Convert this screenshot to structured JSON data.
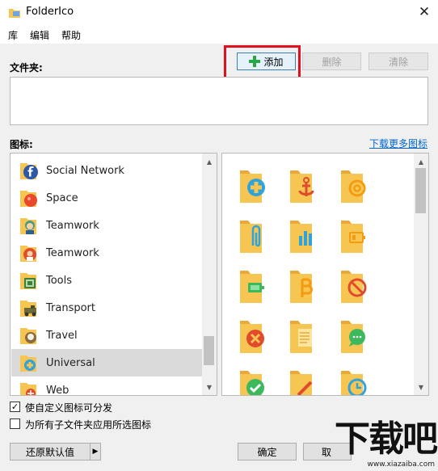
{
  "window": {
    "title": "FolderIco",
    "close_glyph": "✕"
  },
  "menu": [
    "库",
    "编辑",
    "帮助"
  ],
  "folder_section": {
    "label": "文件夹:",
    "add_button": "添加",
    "delete_button": "删除",
    "clear_button": "清除"
  },
  "icons_section": {
    "label": "图标:",
    "download_link": "下载更多图标"
  },
  "icon_list": [
    {
      "name": "Social Network",
      "icon": "facebook-folder-icon",
      "selected": false
    },
    {
      "name": "Space",
      "icon": "space-folder-icon",
      "selected": false
    },
    {
      "name": "Teamwork",
      "icon": "teamwork-folder-icon",
      "selected": false
    },
    {
      "name": "Teamwork",
      "icon": "teamwork-red-folder-icon",
      "selected": false
    },
    {
      "name": "Tools",
      "icon": "tools-folder-icon",
      "selected": false
    },
    {
      "name": "Transport",
      "icon": "transport-folder-icon",
      "selected": false
    },
    {
      "name": "Travel",
      "icon": "travel-folder-icon",
      "selected": false
    },
    {
      "name": "Universal",
      "icon": "universal-folder-icon",
      "selected": true
    },
    {
      "name": "Web",
      "icon": "web-folder-icon",
      "selected": false
    }
  ],
  "icon_grid": [
    "plus-folder-icon",
    "anchor-folder-icon",
    "at-sign-folder-icon",
    "paperclip-folder-icon",
    "bar-chart-folder-icon",
    "battery-low-folder-icon",
    "battery-full-folder-icon",
    "bitcoin-folder-icon",
    "forbidden-folder-icon",
    "delete-folder-icon",
    "document-folder-icon",
    "chat-folder-icon",
    "check-folder-icon",
    "pencil-folder-icon",
    "clock-folder-icon"
  ],
  "options": {
    "custom_distributable": {
      "label": "使自定义图标可分发",
      "checked": true
    },
    "apply_subfolders": {
      "label": "为所有子文件夹应用所选图标",
      "checked": false
    }
  },
  "footer": {
    "restore_default": "还原默认值",
    "ok": "确定",
    "cancel_partial": "取"
  },
  "watermark": {
    "main": "下载吧",
    "url": "www.xiazaiba.com"
  },
  "colors": {
    "folder": "#f7c552",
    "folder_dark": "#e8a93a",
    "accent_blue": "#30a3dd",
    "accent_red": "#e04b2c",
    "accent_green": "#3cb95c",
    "highlight": "#e0101e"
  }
}
